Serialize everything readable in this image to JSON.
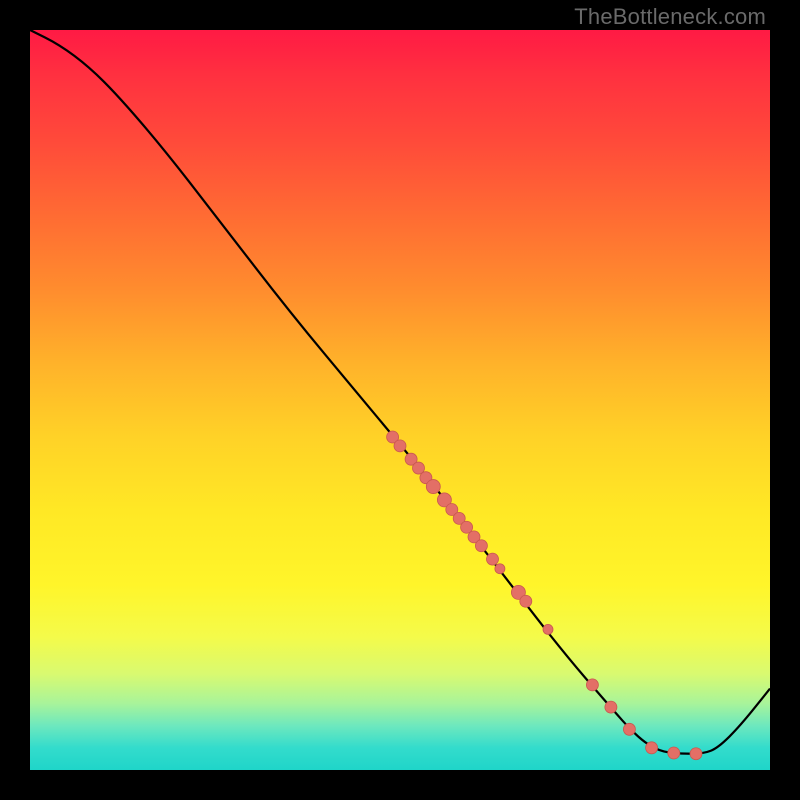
{
  "watermark": "TheBottleneck.com",
  "colors": {
    "curve": "#000000",
    "point_fill": "#e36f66",
    "point_stroke": "#c9584f",
    "gradient_top": "#ff1a44",
    "gradient_bottom": "#1fd5c9",
    "frame": "#000000"
  },
  "chart_data": {
    "type": "line",
    "title": "",
    "xlabel": "",
    "ylabel": "",
    "xlim": [
      0,
      100
    ],
    "ylim": [
      0,
      100
    ],
    "grid": false,
    "legend": false,
    "curve": [
      {
        "x": 0,
        "y": 100
      },
      {
        "x": 4,
        "y": 98
      },
      {
        "x": 8,
        "y": 95
      },
      {
        "x": 12,
        "y": 91
      },
      {
        "x": 18,
        "y": 84
      },
      {
        "x": 25,
        "y": 75
      },
      {
        "x": 35,
        "y": 62
      },
      {
        "x": 45,
        "y": 50
      },
      {
        "x": 55,
        "y": 38
      },
      {
        "x": 65,
        "y": 25
      },
      {
        "x": 72,
        "y": 16
      },
      {
        "x": 78,
        "y": 9
      },
      {
        "x": 82,
        "y": 4.5
      },
      {
        "x": 85,
        "y": 2.5
      },
      {
        "x": 88,
        "y": 2.2
      },
      {
        "x": 91,
        "y": 2.2
      },
      {
        "x": 93,
        "y": 3
      },
      {
        "x": 96,
        "y": 6
      },
      {
        "x": 100,
        "y": 11
      }
    ],
    "points": [
      {
        "x": 49,
        "y": 45,
        "r": 6
      },
      {
        "x": 50,
        "y": 43.8,
        "r": 6
      },
      {
        "x": 51.5,
        "y": 42,
        "r": 6
      },
      {
        "x": 52.5,
        "y": 40.8,
        "r": 6
      },
      {
        "x": 53.5,
        "y": 39.5,
        "r": 6
      },
      {
        "x": 54.5,
        "y": 38.3,
        "r": 7
      },
      {
        "x": 56,
        "y": 36.5,
        "r": 7
      },
      {
        "x": 57,
        "y": 35.2,
        "r": 6
      },
      {
        "x": 58,
        "y": 34,
        "r": 6
      },
      {
        "x": 59,
        "y": 32.8,
        "r": 6
      },
      {
        "x": 60,
        "y": 31.5,
        "r": 6
      },
      {
        "x": 61,
        "y": 30.3,
        "r": 6
      },
      {
        "x": 62.5,
        "y": 28.5,
        "r": 6
      },
      {
        "x": 63.5,
        "y": 27.2,
        "r": 5
      },
      {
        "x": 66,
        "y": 24,
        "r": 7
      },
      {
        "x": 67,
        "y": 22.8,
        "r": 6
      },
      {
        "x": 70,
        "y": 19,
        "r": 5
      },
      {
        "x": 76,
        "y": 11.5,
        "r": 6
      },
      {
        "x": 78.5,
        "y": 8.5,
        "r": 6
      },
      {
        "x": 81,
        "y": 5.5,
        "r": 6
      },
      {
        "x": 84,
        "y": 3,
        "r": 6
      },
      {
        "x": 87,
        "y": 2.3,
        "r": 6
      },
      {
        "x": 90,
        "y": 2.2,
        "r": 6
      }
    ]
  }
}
